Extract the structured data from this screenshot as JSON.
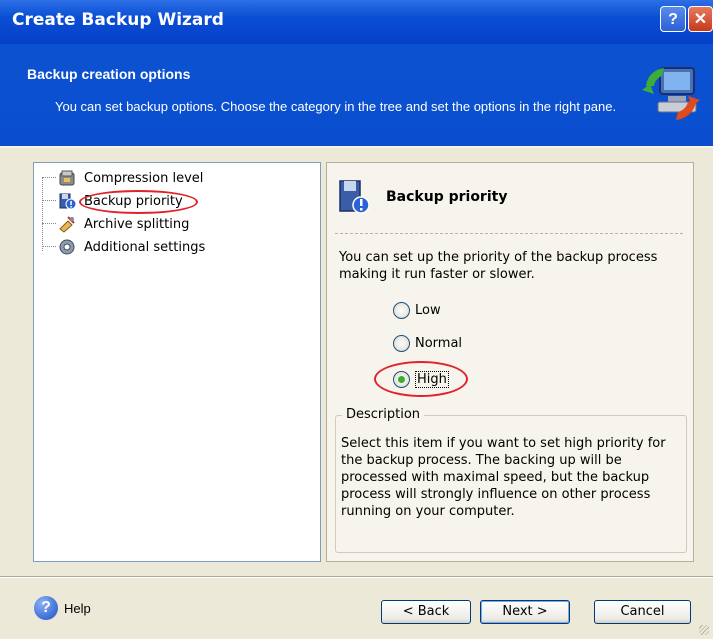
{
  "window": {
    "title": "Create Backup Wizard",
    "help_button": "?",
    "close_button": "✕"
  },
  "header": {
    "heading": "Backup creation options",
    "description": "You can set backup options. Choose the category in the tree and set the options in the right pane."
  },
  "tree": {
    "items": [
      {
        "label": "Compression level",
        "icon": "compression-icon"
      },
      {
        "label": "Backup priority",
        "icon": "priority-icon"
      },
      {
        "label": "Archive splitting",
        "icon": "splitting-icon"
      },
      {
        "label": "Additional settings",
        "icon": "settings-gear-icon"
      }
    ],
    "selected": "Backup priority",
    "highlight_color": "#E0232B"
  },
  "panel": {
    "title": "Backup priority",
    "description": "You can set up the priority of the backup process making it run faster or slower.",
    "options": [
      {
        "label": "Low",
        "checked": false
      },
      {
        "label": "Normal",
        "checked": false
      },
      {
        "label": "High",
        "checked": true
      }
    ],
    "group_title": "Description",
    "group_text": "Select this item if you want to set high priority for the backup process. The backing up will be processed with maximal speed, but the backup process will strongly influence on other process running on your computer."
  },
  "footer": {
    "help_label": "Help",
    "back_label": "< Back",
    "next_label": "Next >",
    "cancel_label": "Cancel"
  },
  "colors": {
    "titlebar": "#0A4ED4",
    "dialog_bg": "#ECE9D8",
    "accent_red": "#E0232B",
    "radio_checked": "#3CAE2C"
  }
}
